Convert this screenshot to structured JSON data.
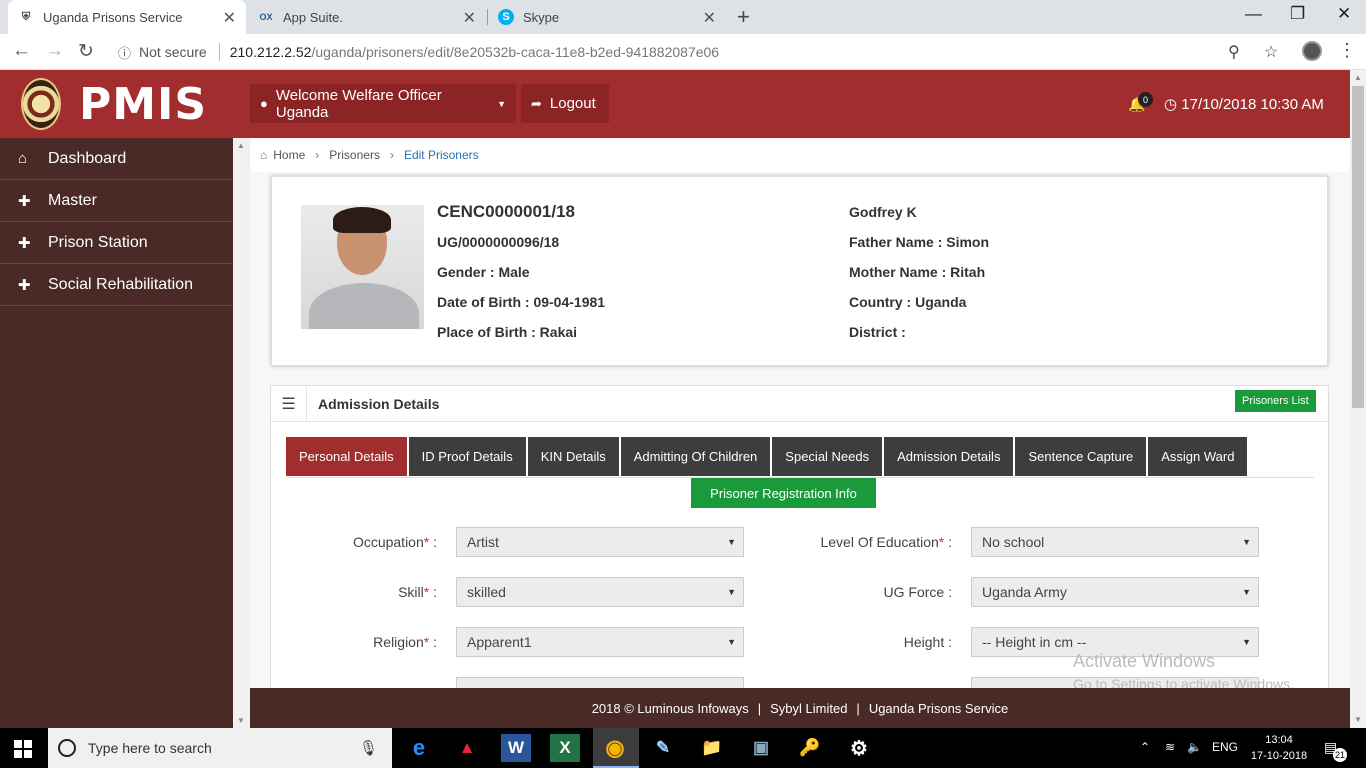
{
  "browser": {
    "tabs": [
      {
        "title": "Uganda Prisons Service",
        "icon": "prison-shield-icon",
        "active": true
      },
      {
        "title": "App Suite.",
        "icon": "ox-icon",
        "active": false
      },
      {
        "title": "Skype",
        "icon": "skype-icon",
        "active": false
      }
    ],
    "address": {
      "security": "Not secure",
      "host": "210.212.2.52",
      "path": "/uganda/prisoners/edit/8e20532b-caca-11e8-b2ed-941882087e06"
    }
  },
  "header": {
    "brand": "PMIS",
    "welcome": "Welcome Welfare Officer Uganda",
    "logout": "Logout",
    "notification_count": "0",
    "datetime": "17/10/2018 10:30 AM",
    "color": "#a12d2f"
  },
  "sidebar": {
    "items": [
      {
        "label": "Dashboard",
        "icon": "home-icon"
      },
      {
        "label": "Master",
        "icon": "plus-icon"
      },
      {
        "label": "Prison Station",
        "icon": "plus-icon"
      },
      {
        "label": "Social Rehabilitation",
        "icon": "plus-icon"
      }
    ]
  },
  "breadcrumb": {
    "home": "Home",
    "section": "Prisoners",
    "current": "Edit Prisoners"
  },
  "profile": {
    "number": "CENC0000001/18",
    "ug_number": "UG/0000000096/18",
    "gender": "Gender : Male",
    "dob": "Date of Birth : 09-04-1981",
    "pob": "Place of Birth : Rakai",
    "name": "Godfrey K",
    "father": "Father Name : Simon",
    "mother": "Mother Name : Ritah",
    "country": "Country : Uganda",
    "district": "District :"
  },
  "admission": {
    "title": "Admission Details",
    "prisoners_list": "Prisoners List",
    "tabs": [
      "Personal Details",
      "ID Proof Details",
      "KIN Details",
      "Admitting Of Children",
      "Special Needs",
      "Admission Details",
      "Sentence Capture",
      "Assign Ward"
    ],
    "reg_info": "Prisoner Registration Info",
    "fields": {
      "occupation": {
        "label": "Occupation",
        "value": "Artist"
      },
      "education": {
        "label": "Level Of Education",
        "value": "No school"
      },
      "skill": {
        "label": "Skill",
        "value": "skilled"
      },
      "ug_force": {
        "label": "UG Force :",
        "value": "Uganda Army"
      },
      "religion": {
        "label": "Religion",
        "value": "Apparent1"
      },
      "height": {
        "label": "Height :",
        "value": "-- Height in cm --"
      }
    }
  },
  "watermark": {
    "title": "Activate Windows",
    "sub": "Go to Settings to activate Windows."
  },
  "footer": {
    "copyright": "2018 © Luminous Infoways",
    "company": "Sybyl Limited",
    "org": "Uganda Prisons Service"
  },
  "taskbar": {
    "search_placeholder": "Type here to search",
    "lang": "ENG",
    "time": "13:04",
    "date": "17-10-2018",
    "notifications": "21"
  }
}
